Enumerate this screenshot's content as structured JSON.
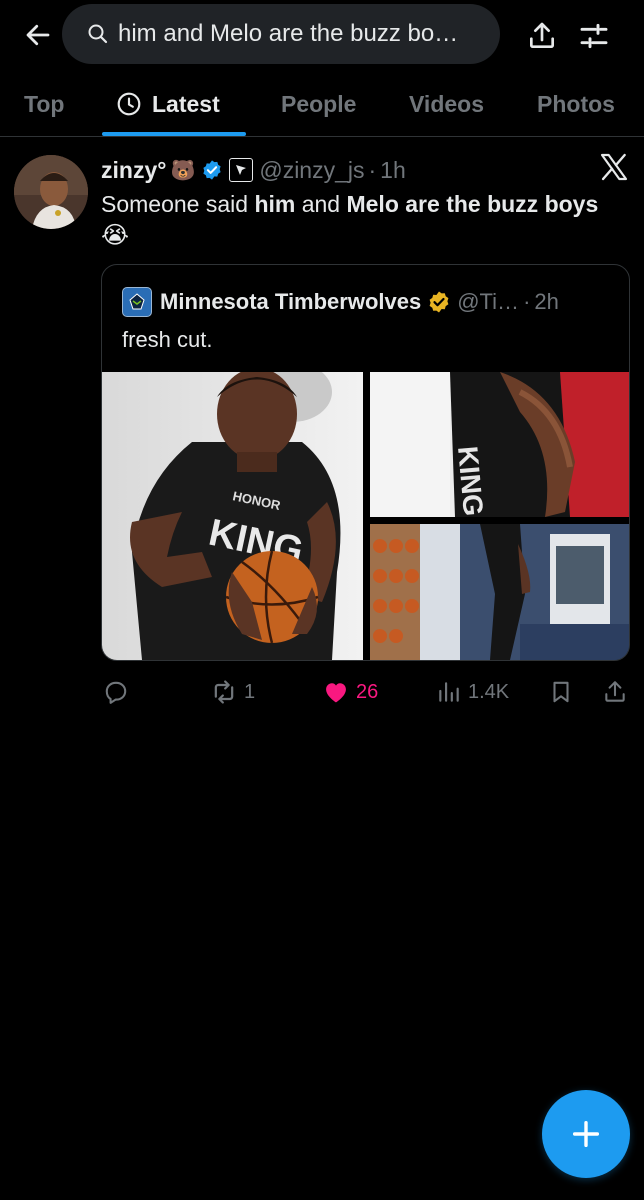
{
  "search": {
    "query": "him and Melo are the buzz bo…"
  },
  "tabs": [
    "Top",
    "Latest",
    "People",
    "Videos",
    "Photos"
  ],
  "active_tab": "Latest",
  "post": {
    "display_name": "zinzy°",
    "name_emoji": "🐻",
    "handle": "@zinzy_js",
    "dot": "·",
    "time": "1h",
    "text_parts": [
      "Someone said ",
      "him",
      " and ",
      "Melo are the buzz boys"
    ],
    "emoji": "😭",
    "quote": {
      "display_name": "Minnesota Timberwolves",
      "handle": "@Ti…",
      "dot": "·",
      "time": "2h",
      "text": "fresh cut.",
      "jersey_text": "HONOR KING"
    },
    "stats": {
      "replies": "",
      "reposts": "1",
      "likes": "26",
      "views": "1.4K"
    }
  },
  "colors": {
    "accent": "#1d9bf0",
    "like": "#f91880",
    "muted": "#71767b",
    "gold": "#e8b423"
  },
  "icons": [
    "back-arrow-icon",
    "search-icon",
    "share-icon",
    "filter-icon",
    "clock-icon",
    "verified-badge-icon",
    "x-logo-icon",
    "reply-icon",
    "repost-icon",
    "heart-icon",
    "views-icon",
    "bookmark-icon",
    "compose-plus-icon"
  ]
}
